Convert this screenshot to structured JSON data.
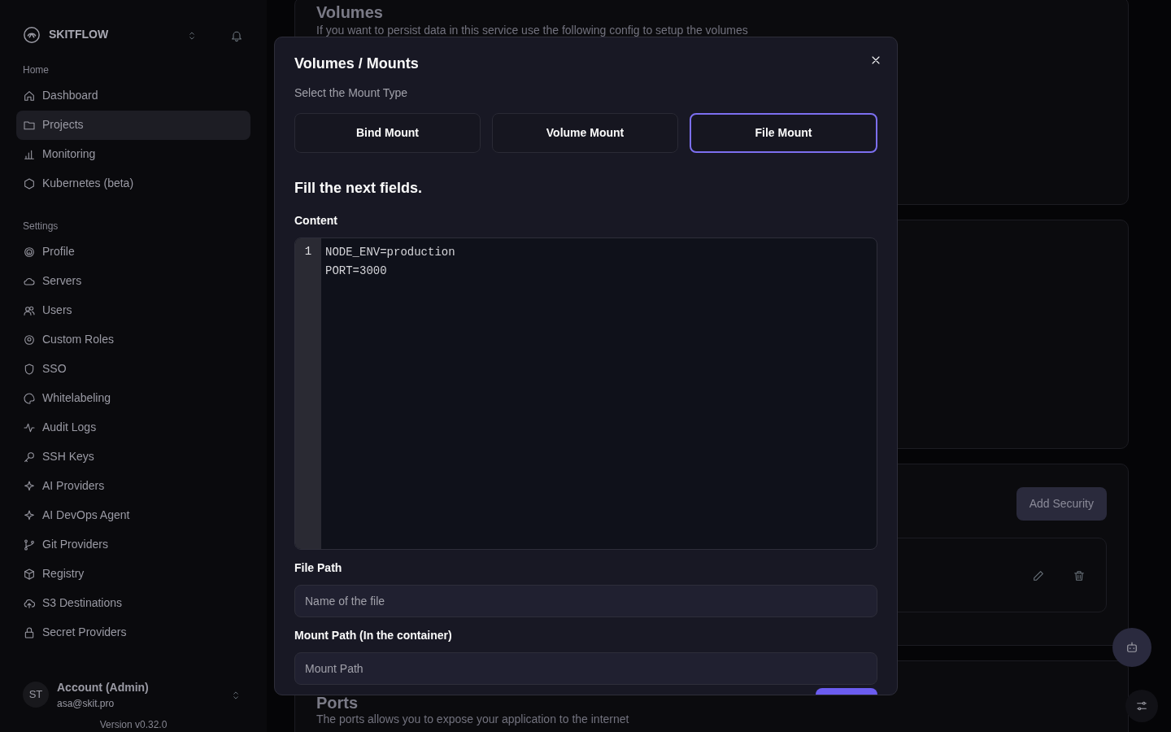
{
  "sidebar": {
    "brand": "SKITFLOW",
    "sections": [
      {
        "title": "Home",
        "items": [
          {
            "label": "Dashboard",
            "selected": false
          },
          {
            "label": "Projects",
            "selected": true
          },
          {
            "label": "Monitoring",
            "selected": false
          },
          {
            "label": "Kubernetes (beta)",
            "selected": false
          }
        ]
      },
      {
        "title": "Settings",
        "items": [
          {
            "label": "Profile",
            "selected": false
          },
          {
            "label": "Servers",
            "selected": false
          },
          {
            "label": "Users",
            "selected": false
          },
          {
            "label": "Custom Roles",
            "selected": false
          },
          {
            "label": "SSO",
            "selected": false
          },
          {
            "label": "Whitelabeling",
            "selected": false
          },
          {
            "label": "Audit Logs",
            "selected": false
          },
          {
            "label": "SSH Keys",
            "selected": false
          },
          {
            "label": "AI Providers",
            "selected": false
          },
          {
            "label": "AI DevOps Agent",
            "selected": false
          },
          {
            "label": "Git Providers",
            "selected": false
          },
          {
            "label": "Registry",
            "selected": false
          },
          {
            "label": "S3 Destinations",
            "selected": false
          },
          {
            "label": "Secret Providers",
            "selected": false
          }
        ]
      }
    ],
    "account": {
      "initials": "ST",
      "name": "Account (Admin)",
      "email": "asa@skit.pro"
    },
    "version": "Version v0.32.0"
  },
  "background": {
    "volumes": {
      "title": "Volumes",
      "description": "If you want to persist data in this service use the following config to setup the volumes"
    },
    "add_security_button": "Add Security",
    "ports": {
      "title": "Ports",
      "description": "The ports allows you to expose your application to the internet"
    }
  },
  "modal": {
    "title": "Volumes / Mounts",
    "mount_type_label": "Select the Mount Type",
    "mount_types": [
      {
        "label": "Bind Mount",
        "selected": false
      },
      {
        "label": "Volume Mount",
        "selected": false
      },
      {
        "label": "File Mount",
        "selected": true
      }
    ],
    "fields_heading": "Fill the next fields.",
    "content": {
      "label": "Content",
      "line_numbers": [
        "1"
      ],
      "value": "NODE_ENV=production\nPORT=3000"
    },
    "file_path": {
      "label": "File Path",
      "placeholder": "Name of the file"
    },
    "mount_path": {
      "label": "Mount Path (In the container)",
      "placeholder": "Mount Path"
    }
  }
}
